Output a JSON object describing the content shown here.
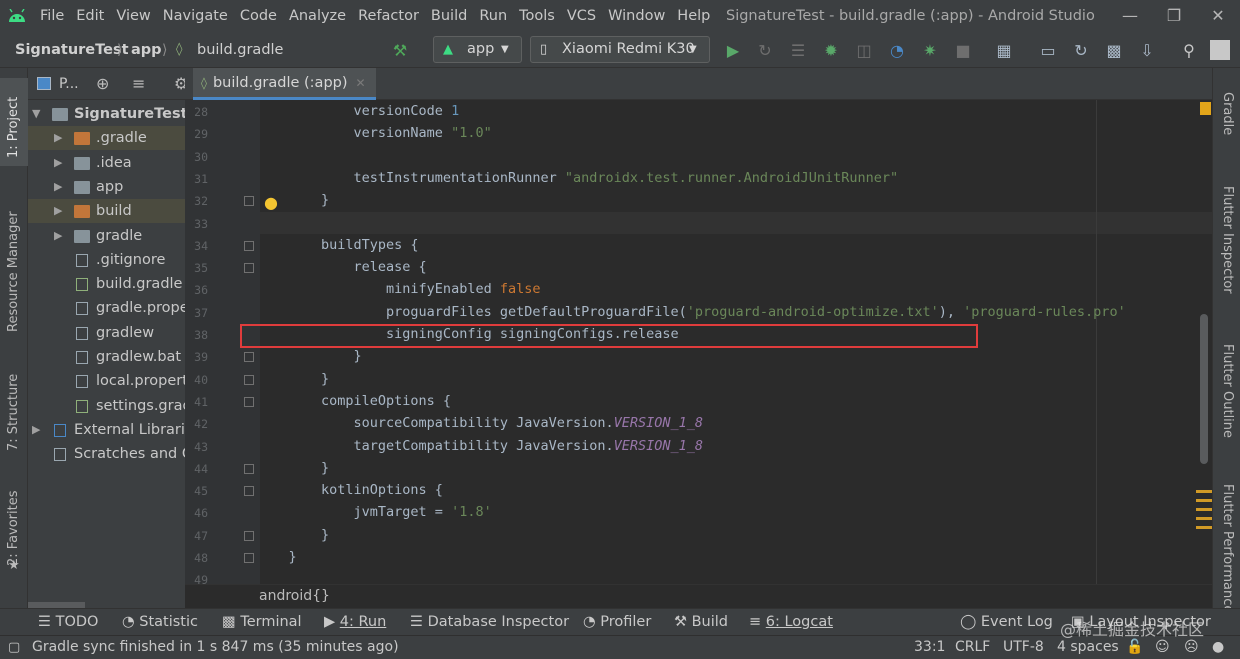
{
  "window": {
    "title": "SignatureTest - build.gradle (:app) - Android Studio"
  },
  "menu": [
    "File",
    "Edit",
    "View",
    "Navigate",
    "Code",
    "Analyze",
    "Refactor",
    "Build",
    "Run",
    "Tools",
    "VCS",
    "Window",
    "Help"
  ],
  "navbar": {
    "breadcrumb": [
      "SignatureTest",
      "app",
      "build.gradle"
    ],
    "run_config": "app",
    "device": "Xiaomi Redmi K30"
  },
  "project_panel": {
    "view_label": "P...",
    "items": [
      {
        "label": "SignatureTest",
        "icon": "module-folder-icon",
        "expanded": true
      },
      {
        "label": ".gradle",
        "icon": "folder-orange-icon"
      },
      {
        "label": ".idea",
        "icon": "folder-icon"
      },
      {
        "label": "app",
        "icon": "android-module-folder-icon"
      },
      {
        "label": "build",
        "icon": "folder-orange-icon"
      },
      {
        "label": "gradle",
        "icon": "folder-icon"
      },
      {
        "label": ".gitignore",
        "icon": "text-file-icon"
      },
      {
        "label": "build.gradle",
        "icon": "gradle-file-icon"
      },
      {
        "label": "gradle.proper",
        "icon": "properties-file-icon"
      },
      {
        "label": "gradlew",
        "icon": "script-file-icon"
      },
      {
        "label": "gradlew.bat",
        "icon": "text-file-icon"
      },
      {
        "label": "local.properti",
        "icon": "properties-file-icon"
      },
      {
        "label": "settings.grad",
        "icon": "gradle-file-icon"
      },
      {
        "label": "External Librarie",
        "icon": "library-icon"
      },
      {
        "label": "Scratches and Co",
        "icon": "scratches-icon"
      }
    ]
  },
  "editor": {
    "tab": "build.gradle (:app)",
    "lines": [
      {
        "num": "28",
        "parts": [
          [
            "",
            "            versionCode "
          ],
          [
            "n",
            "1"
          ]
        ]
      },
      {
        "num": "29",
        "parts": [
          [
            "",
            "            versionName "
          ],
          [
            "s",
            "\"1.0\""
          ]
        ]
      },
      {
        "num": "30",
        "parts": [
          [
            "",
            ""
          ]
        ]
      },
      {
        "num": "31",
        "parts": [
          [
            "",
            "            testInstrumentationRunner "
          ],
          [
            "s",
            "\"androidx.test.runner.AndroidJUnitRunner\""
          ]
        ]
      },
      {
        "num": "32",
        "parts": [
          [
            "",
            "        }"
          ]
        ]
      },
      {
        "num": "33",
        "parts": [
          [
            "",
            ""
          ]
        ]
      },
      {
        "num": "34",
        "parts": [
          [
            "",
            "        buildTypes {"
          ]
        ]
      },
      {
        "num": "35",
        "parts": [
          [
            "",
            "            release {"
          ]
        ]
      },
      {
        "num": "36",
        "parts": [
          [
            "",
            "                minifyEnabled "
          ],
          [
            "k",
            "false"
          ]
        ]
      },
      {
        "num": "37",
        "parts": [
          [
            "",
            "                proguardFiles getDefaultProguardFile("
          ],
          [
            "s",
            "'proguard-android-optimize.txt'"
          ],
          [
            "",
            "), "
          ],
          [
            "s",
            "'proguard-rules.pro'"
          ]
        ]
      },
      {
        "num": "38",
        "parts": [
          [
            "",
            "                signingConfig signingConfigs.release"
          ]
        ]
      },
      {
        "num": "39",
        "parts": [
          [
            "",
            "            }"
          ]
        ]
      },
      {
        "num": "40",
        "parts": [
          [
            "",
            "        }"
          ]
        ]
      },
      {
        "num": "41",
        "parts": [
          [
            "",
            "        compileOptions {"
          ]
        ]
      },
      {
        "num": "42",
        "parts": [
          [
            "",
            "            sourceCompatibility JavaVersion."
          ],
          [
            "it",
            "VERSION_1_8"
          ]
        ]
      },
      {
        "num": "43",
        "parts": [
          [
            "",
            "            targetCompatibility JavaVersion."
          ],
          [
            "it",
            "VERSION_1_8"
          ]
        ]
      },
      {
        "num": "44",
        "parts": [
          [
            "",
            "        }"
          ]
        ]
      },
      {
        "num": "45",
        "parts": [
          [
            "",
            "        kotlinOptions {"
          ]
        ]
      },
      {
        "num": "46",
        "parts": [
          [
            "",
            "            jvmTarget = "
          ],
          [
            "s",
            "'1.8'"
          ]
        ]
      },
      {
        "num": "47",
        "parts": [
          [
            "",
            "        }"
          ]
        ]
      },
      {
        "num": "48",
        "parts": [
          [
            "",
            "    }"
          ]
        ]
      },
      {
        "num": "49",
        "parts": [
          [
            "",
            ""
          ]
        ]
      }
    ],
    "breadcrumb": "android{}"
  },
  "left_stripe": [
    "1: Project",
    "Resource Manager",
    "7: Structure",
    "2: Favorites"
  ],
  "right_stripe": [
    "Gradle",
    "Flutter Inspector",
    "Flutter Outline",
    "Flutter Performance"
  ],
  "bottom_tools": [
    "TODO",
    "Statistic",
    "Terminal",
    "4: Run",
    "Database Inspector",
    "Profiler",
    "Build",
    "6: Logcat",
    "Event Log",
    "Layout Inspector"
  ],
  "status": {
    "message": "Gradle sync finished in 1 s 847 ms (35 minutes ago)",
    "position": "33:1",
    "line_sep": "CRLF",
    "encoding": "UTF-8",
    "indent": "4 spaces",
    "watermark": "@稀土掘金技术社区"
  },
  "colors": {
    "highlight_box": "#e03c3c",
    "caret_line": "#323232",
    "keyword": "#cc7832",
    "string": "#6a8759",
    "number": "#6897bb"
  }
}
